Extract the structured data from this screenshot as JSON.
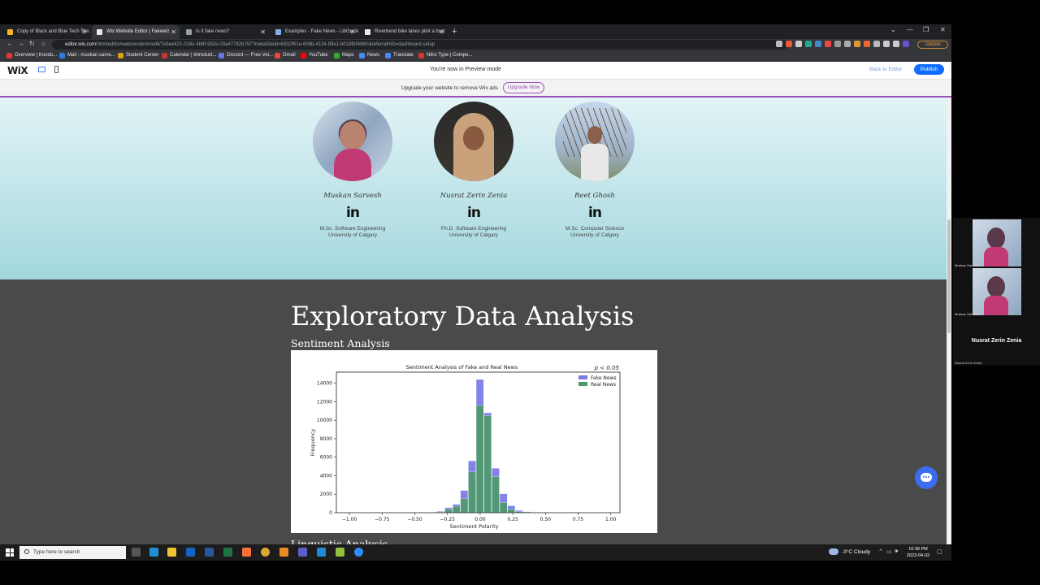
{
  "browser": {
    "tabs": [
      {
        "title": "Copy of Black and Blue Tech The...",
        "active": false,
        "favicon_color": "#f2b824"
      },
      {
        "title": "Wix Website Editor | Fakewiz",
        "active": true,
        "favicon_color": "#e8eaed"
      },
      {
        "title": "Is it fake news?",
        "active": false,
        "favicon_color": "#9aa0a6"
      },
      {
        "title": "Examples - Fake News - LibGuides",
        "active": false,
        "favicon_color": "#7fb0e8"
      },
      {
        "title": "Riverbend bike lanes pilot a bust",
        "active": false,
        "favicon_color": "#e8eaed"
      }
    ],
    "new_tab_label": "+",
    "window_controls": [
      "⌄",
      "—",
      "❐",
      "✕"
    ],
    "url_host": "editor.wix.com",
    "url_path": "/html/editor/web/renderer/edit/7e5ee421-018c-4b8f-932e-03a47782b767?metaSiteId=b932f61e-606b-4134-89e1-b018fbf4b6fc&referralInfo=dashboard-setup",
    "update_label": "Update",
    "bookmarks": [
      {
        "label": "Overview | Koodo...",
        "color": "#e33"
      },
      {
        "label": "Mail - muskan.sarve...",
        "color": "#2a7de1"
      },
      {
        "label": "Student Center",
        "color": "#d4a017"
      },
      {
        "label": "Calendar | Introduct...",
        "color": "#c33"
      },
      {
        "label": "Discord — Free Voi...",
        "color": "#6a75e8"
      },
      {
        "label": "Gmail",
        "color": "#e44"
      },
      {
        "label": "YouTube",
        "color": "#f00"
      },
      {
        "label": "Maps",
        "color": "#3a3"
      },
      {
        "label": "News",
        "color": "#4a8af4"
      },
      {
        "label": "Translate",
        "color": "#4a8af4"
      },
      {
        "label": "Nitro Type | Compe...",
        "color": "#d33"
      }
    ]
  },
  "wix": {
    "logo": "WiX",
    "preview_text": "You're now in Preview mode",
    "back_to_editor": "Back to Editor",
    "publish": "Publish",
    "ad_text": "Upgrade your website to remove Wix ads",
    "upgrade_now": "Upgrade Now"
  },
  "team": [
    {
      "name": "Muskan Sarvesh",
      "linkedin": "in",
      "degree": "M.Sc. Software Engineering",
      "university": "University of Calgary"
    },
    {
      "name": "Nusrat Zerin Zenia",
      "linkedin": "in",
      "degree": "Ph.D. Software Engineering",
      "university": "University of Calgary"
    },
    {
      "name": "Reet Ghosh",
      "linkedin": "in",
      "degree": "M.Sc. Computer Science",
      "university": "University of Calgary"
    }
  ],
  "eda": {
    "title": "Exploratory Data Analysis",
    "subtitle": "Sentiment Analysis",
    "next_heading": "Linguistic Analysis"
  },
  "chart_data": {
    "type": "bar",
    "title": "Sentiment Analysis of Fake and Real News",
    "annotation": "p < 0.05",
    "xlabel": "Sentiment Polarity",
    "ylabel": "Frequency",
    "xlim": [
      -1.1,
      1.07
    ],
    "ylim": [
      0,
      15200
    ],
    "xticks": [
      "−1.00",
      "−0.75",
      "−0.50",
      "−0.25",
      "0.00",
      "0.25",
      "0.50",
      "0.75",
      "1.00"
    ],
    "xtick_values": [
      -1.0,
      -0.75,
      -0.5,
      -0.25,
      0.0,
      0.25,
      0.5,
      0.75,
      1.0
    ],
    "yticks": [
      0,
      2000,
      4000,
      6000,
      8000,
      10000,
      12000,
      14000
    ],
    "bin_width": 0.06,
    "bin_starts": [
      -0.39,
      -0.33,
      -0.27,
      -0.21,
      -0.15,
      -0.09,
      -0.03,
      0.03,
      0.09,
      0.15,
      0.21,
      0.27,
      0.33,
      0.39,
      0.45
    ],
    "series": [
      {
        "name": "Fake News",
        "color": "#7b7be8",
        "values": [
          50,
          150,
          550,
          900,
          2400,
          5600,
          14400,
          10800,
          4800,
          2050,
          750,
          250,
          100,
          40,
          15
        ]
      },
      {
        "name": "Real News",
        "color": "#4c9a6a",
        "values": [
          20,
          80,
          350,
          700,
          1500,
          4400,
          11600,
          10500,
          3900,
          1100,
          350,
          100,
          40,
          15,
          5
        ]
      }
    ],
    "legend_position": "top-right",
    "grid": false
  },
  "taskbar": {
    "search_placeholder": "Type here to search",
    "apps": [
      "task-view",
      "edge",
      "file-explorer",
      "outlook",
      "word",
      "excel",
      "firefox",
      "chrome",
      "vlc",
      "teams",
      "photos",
      "notepad-plus",
      "zoom"
    ],
    "weather": "-3°C  Cloudy",
    "time": "10:38 PM",
    "date": "2023-04-02"
  },
  "call": {
    "participants": [
      "Muskan Sarvesh",
      "Muskan Sarvesh"
    ],
    "speaker": "Nusrat Zerin Zenia",
    "speaker_label": "Nusrat Zerin Zenia"
  }
}
